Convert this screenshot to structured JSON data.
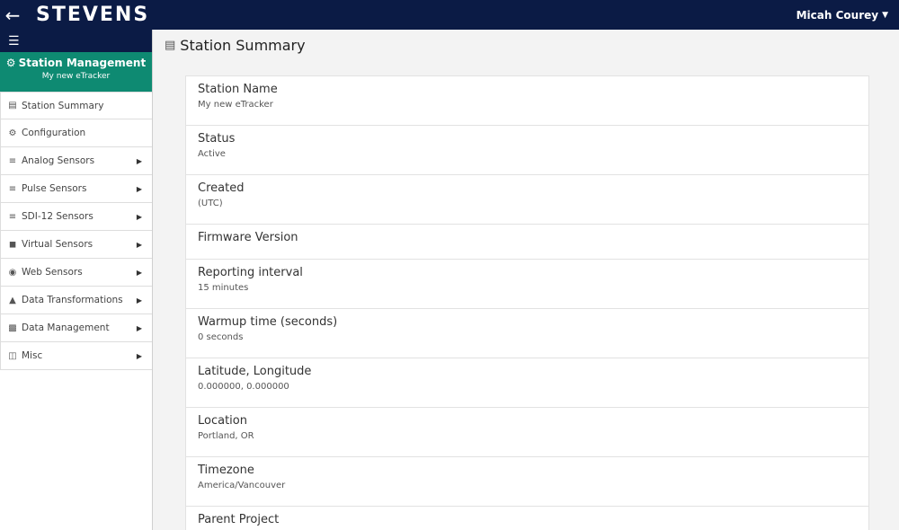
{
  "topbar": {
    "logo": "STEVENS",
    "user_name": "Micah Courey"
  },
  "sidebar": {
    "header_title": "Station Management",
    "header_subtitle": "My new eTracker",
    "items": [
      {
        "label": "Station Summary",
        "icon": "chart-icon",
        "has_submenu": false
      },
      {
        "label": "Configuration",
        "icon": "gear-icon",
        "has_submenu": false
      },
      {
        "label": "Analog Sensors",
        "icon": "sliders-icon",
        "has_submenu": true
      },
      {
        "label": "Pulse Sensors",
        "icon": "sliders-icon",
        "has_submenu": true
      },
      {
        "label": "SDI-12 Sensors",
        "icon": "sliders-icon",
        "has_submenu": true
      },
      {
        "label": "Virtual Sensors",
        "icon": "cubes-icon",
        "has_submenu": true
      },
      {
        "label": "Web Sensors",
        "icon": "globe-icon",
        "has_submenu": true
      },
      {
        "label": "Data Transformations",
        "icon": "flask-icon",
        "has_submenu": true
      },
      {
        "label": "Data Management",
        "icon": "database-icon",
        "has_submenu": true
      },
      {
        "label": "Misc",
        "icon": "folder-icon",
        "has_submenu": true
      }
    ]
  },
  "main": {
    "title": "Station Summary",
    "fields": [
      {
        "label": "Station Name",
        "value": "My new eTracker"
      },
      {
        "label": "Status",
        "value": "Active"
      },
      {
        "label": "Created",
        "value": "(UTC)"
      },
      {
        "label": "Firmware Version",
        "value": ""
      },
      {
        "label": "Reporting interval",
        "value": "15 minutes"
      },
      {
        "label": "Warmup time (seconds)",
        "value": "0 seconds"
      },
      {
        "label": "Latitude, Longitude",
        "value": "0.000000, 0.000000"
      },
      {
        "label": "Location",
        "value": "Portland, OR"
      },
      {
        "label": "Timezone",
        "value": "America/Vancouver"
      },
      {
        "label": "Parent Project",
        "value": ""
      }
    ]
  },
  "colors": {
    "topbar": "#0b1b45",
    "accent": "#0e8a72",
    "logo_accent": "#2bb6a4"
  }
}
